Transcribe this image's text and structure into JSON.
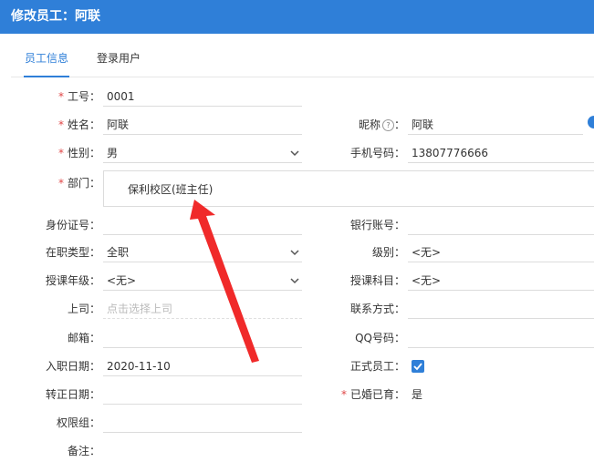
{
  "title": "修改员工：阿联",
  "tabs": [
    {
      "label": "员工信息"
    },
    {
      "label": "登录用户"
    }
  ],
  "required_mark": "*",
  "fields": {
    "emp_no": {
      "label": "工号：",
      "value": "0001"
    },
    "name": {
      "label": "姓名：",
      "value": "阿联"
    },
    "nickname": {
      "label": "昵称",
      "suffix": "：",
      "value": "阿联",
      "help_glyph": "?"
    },
    "gender": {
      "label": "性别：",
      "value": "男"
    },
    "phone": {
      "label": "手机号码：",
      "value": "13807776666"
    },
    "dept": {
      "label": "部门：",
      "value": "保利校区(班主任)"
    },
    "id_card": {
      "label": "身份证号：",
      "value": ""
    },
    "bank_account": {
      "label": "银行账号：",
      "value": ""
    },
    "job_type": {
      "label": "在职类型：",
      "value": "全职"
    },
    "level": {
      "label": "级别：",
      "value": "<无>"
    },
    "grade": {
      "label": "授课年级：",
      "value": "<无>"
    },
    "subject": {
      "label": "授课科目：",
      "value": "<无>"
    },
    "superior": {
      "label": "上司：",
      "placeholder": "点击选择上司"
    },
    "contact": {
      "label": "联系方式：",
      "value": ""
    },
    "email": {
      "label": "邮箱：",
      "value": ""
    },
    "qq": {
      "label": "QQ号码：",
      "value": ""
    },
    "hire_date": {
      "label": "入职日期：",
      "value": "2020-11-10"
    },
    "regular": {
      "label": "正式员工：",
      "checked": true
    },
    "confirm_date": {
      "label": "转正日期：",
      "value": ""
    },
    "married": {
      "label": "已婚已育：",
      "value": "是"
    },
    "perm_group": {
      "label": "权限组：",
      "value": ""
    },
    "remark": {
      "label": "备注：",
      "value": ""
    }
  },
  "icons": {
    "select_arrow": "chevron-down-icon",
    "checkbox_mark": "check-icon",
    "help": "help-circle-icon",
    "annotation": "red-arrow"
  },
  "colors": {
    "primary": "#2f7fd8",
    "required": "#e04646",
    "annotation_arrow": "#f02a2a"
  }
}
